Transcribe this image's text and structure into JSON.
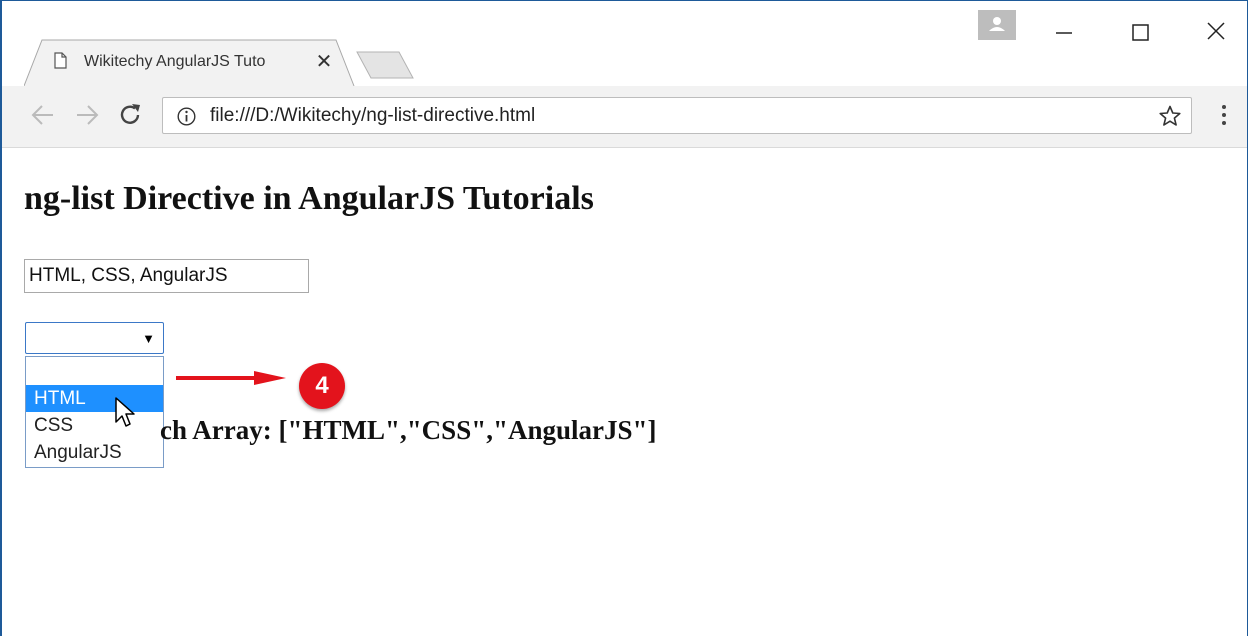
{
  "browser": {
    "tab_title": "Wikitechy AngularJS Tuto",
    "tab_close": "✕",
    "url": "file:///D:/Wikitechy/ng-list-directive.html"
  },
  "page": {
    "heading": "ng-list Directive in AngularJS Tutorials",
    "input_value": "HTML, CSS, AngularJS",
    "select_value": "",
    "dropdown_options": [
      "",
      "HTML",
      "CSS",
      "AngularJS"
    ],
    "array_text": "ch Array: [\"HTML\",\"CSS\",\"AngularJS\"]"
  },
  "annotation": {
    "step_number": "4",
    "badge_color": "#e3131c",
    "arrow_color": "#e3131c"
  },
  "icons": [
    "page-icon",
    "close-icon",
    "new-tab-icon",
    "profile-icon",
    "minimize-icon",
    "maximize-icon",
    "window-close-icon",
    "back-icon",
    "forward-icon",
    "reload-icon",
    "info-icon",
    "star-icon",
    "menu-icon",
    "mouse-cursor-icon"
  ]
}
